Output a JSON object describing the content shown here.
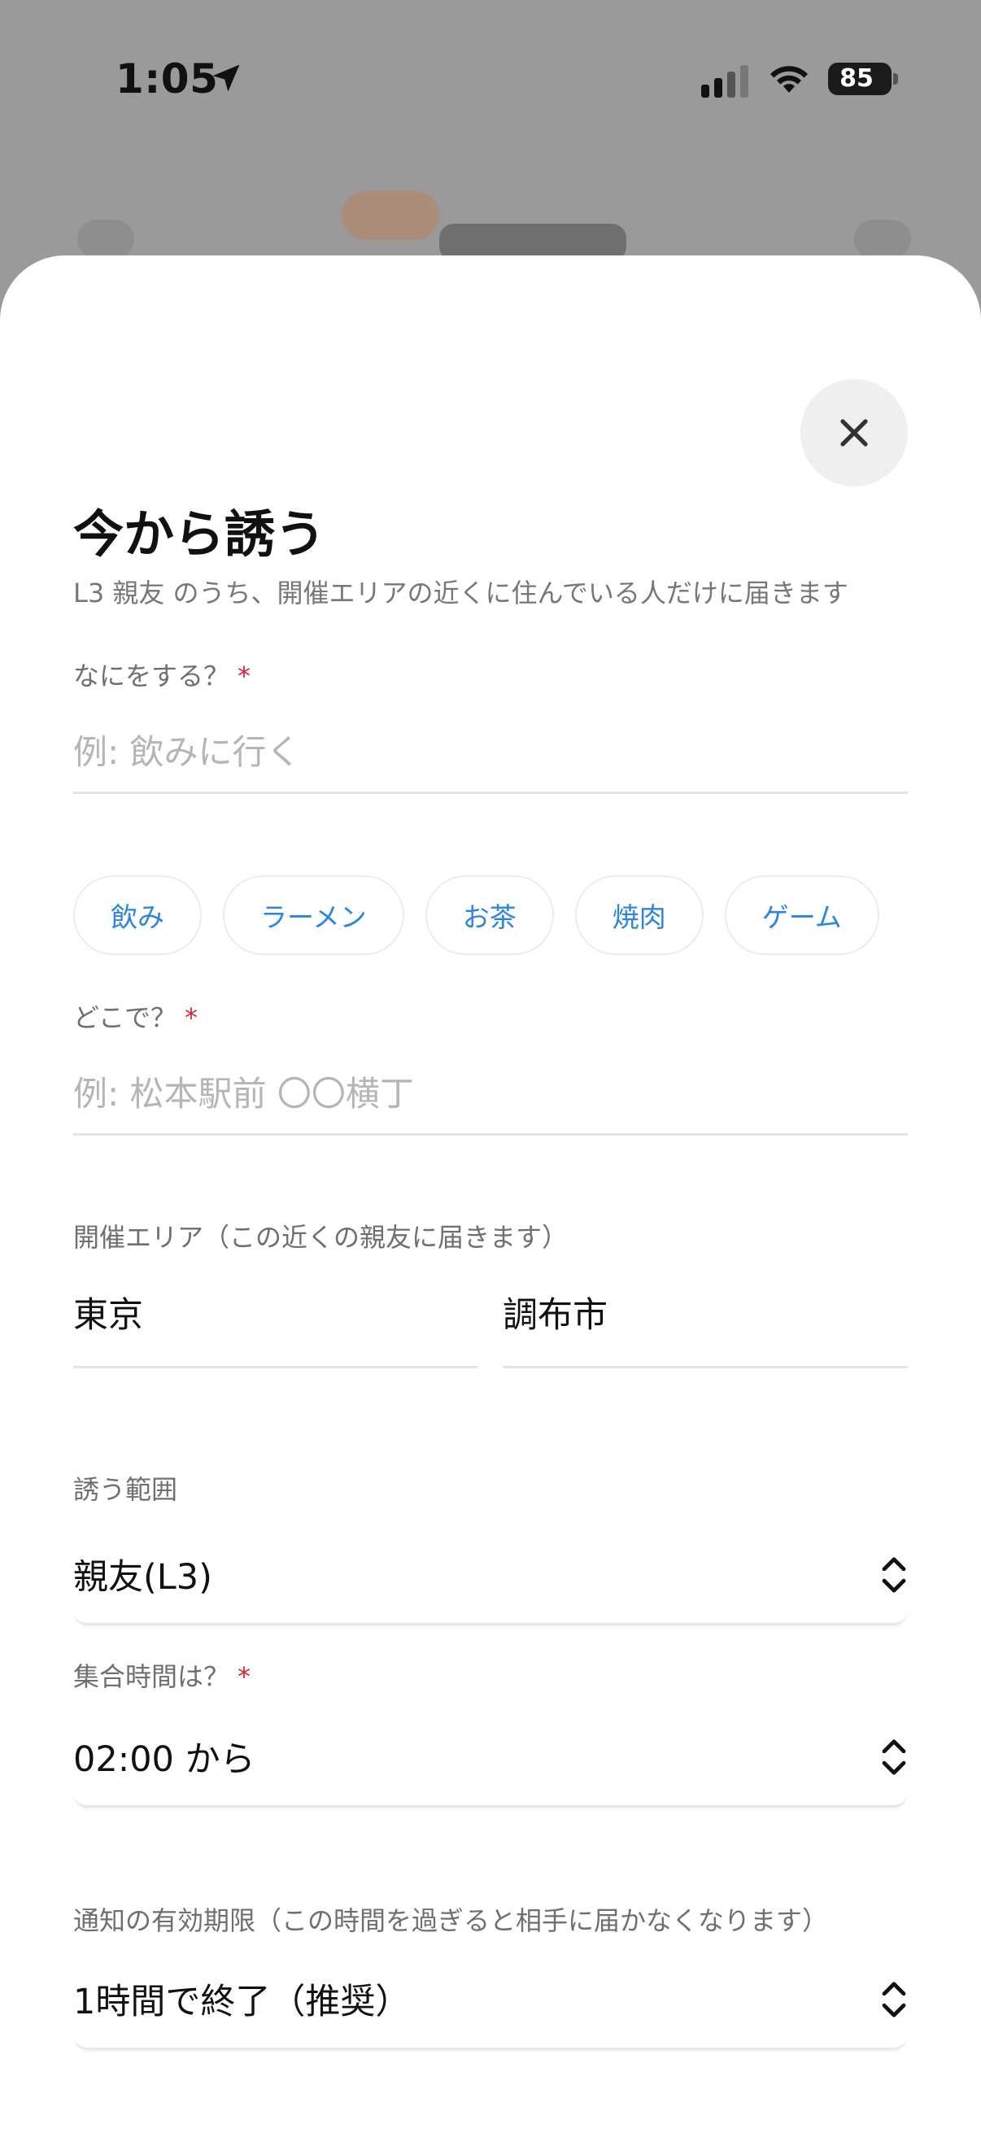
{
  "status_bar": {
    "time": "1:05",
    "battery": "85",
    "icons": [
      "location-arrow-icon",
      "cellular-signal-icon",
      "wifi-icon",
      "battery-icon"
    ]
  },
  "sheet": {
    "title": "今から誘う",
    "subtitle": "L3 親友 のうち、開催エリアの近くに住んでいる人だけに届きます",
    "close_icon": "close-icon",
    "required_mark": "*"
  },
  "what": {
    "label": "なにをする？",
    "placeholder": "例: 飲みに行く",
    "chips": [
      "飲み",
      "ラーメン",
      "お茶",
      "焼肉",
      "ゲーム"
    ]
  },
  "where": {
    "label": "どこで？",
    "placeholder": "例: 松本駅前 〇〇横丁"
  },
  "area": {
    "label": "開催エリア（この近くの親友に届きます）",
    "prefecture": "東京",
    "city": "調布市"
  },
  "scope": {
    "label": "誘う範囲",
    "value": "親友(L3)"
  },
  "meet_time": {
    "label": "集合時間は？",
    "value": "02:00 から"
  },
  "expiry": {
    "label": "通知の有効期限（この時間を過ぎると相手に届かなくなります）",
    "value": "1時間で終了（推奨）"
  },
  "colors": {
    "accent": "#2a86e0",
    "required": "#e0243a",
    "overlay": "#9a9a9a"
  }
}
